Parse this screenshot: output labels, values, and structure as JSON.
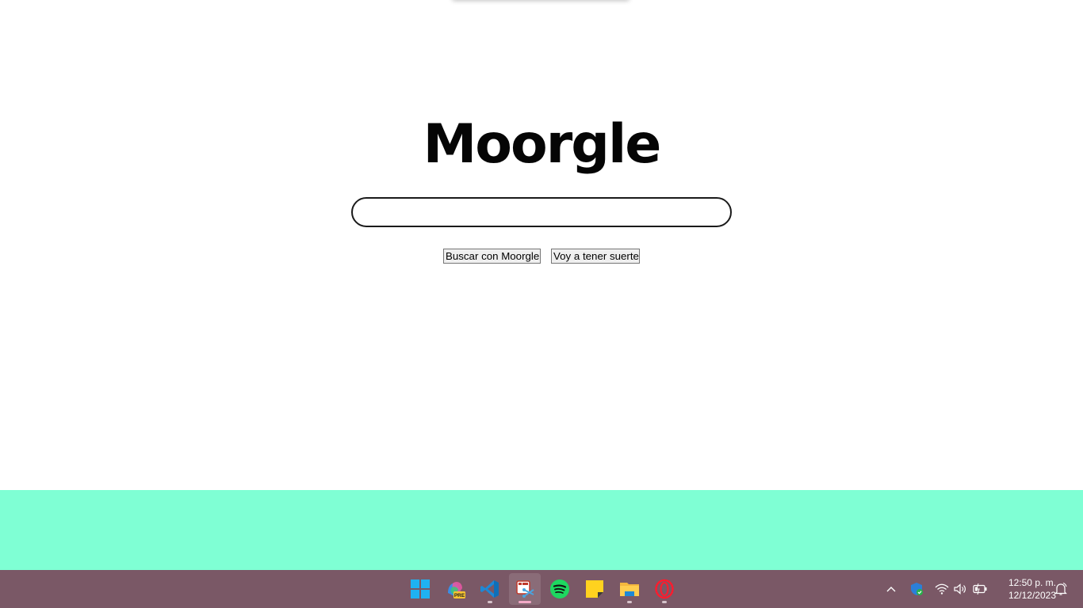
{
  "page": {
    "logo_text": "Moorgle",
    "search": {
      "value": "",
      "placeholder": ""
    },
    "buttons": {
      "search_label": "Buscar con Moorgle",
      "lucky_label": "Voy a tener suerte"
    },
    "footer_color": "#7fffd4"
  },
  "taskbar": {
    "background": "#7a5866",
    "apps": [
      {
        "name": "start-button",
        "icon": "windows-logo-icon",
        "running": false,
        "active": false
      },
      {
        "name": "copilot-preview",
        "icon": "copilot-pre-icon",
        "badge": "PRE",
        "running": false,
        "active": false
      },
      {
        "name": "vscode",
        "icon": "vscode-icon",
        "running": true,
        "active": false
      },
      {
        "name": "snipping-tool",
        "icon": "snipping-tool-icon",
        "running": true,
        "active": true
      },
      {
        "name": "spotify",
        "icon": "spotify-icon",
        "running": false,
        "active": false
      },
      {
        "name": "sticky-notes",
        "icon": "sticky-notes-icon",
        "running": false,
        "active": false
      },
      {
        "name": "file-explorer",
        "icon": "folder-icon",
        "running": true,
        "active": false
      },
      {
        "name": "opera",
        "icon": "opera-icon",
        "running": true,
        "active": false
      }
    ],
    "tray": {
      "icons": [
        "chevron-up-icon",
        "security-shield-icon",
        "wifi-icon",
        "volume-icon",
        "battery-icon",
        "notification-bell-icon"
      ],
      "time": "12:50 p. m.",
      "date": "12/12/2023"
    }
  }
}
